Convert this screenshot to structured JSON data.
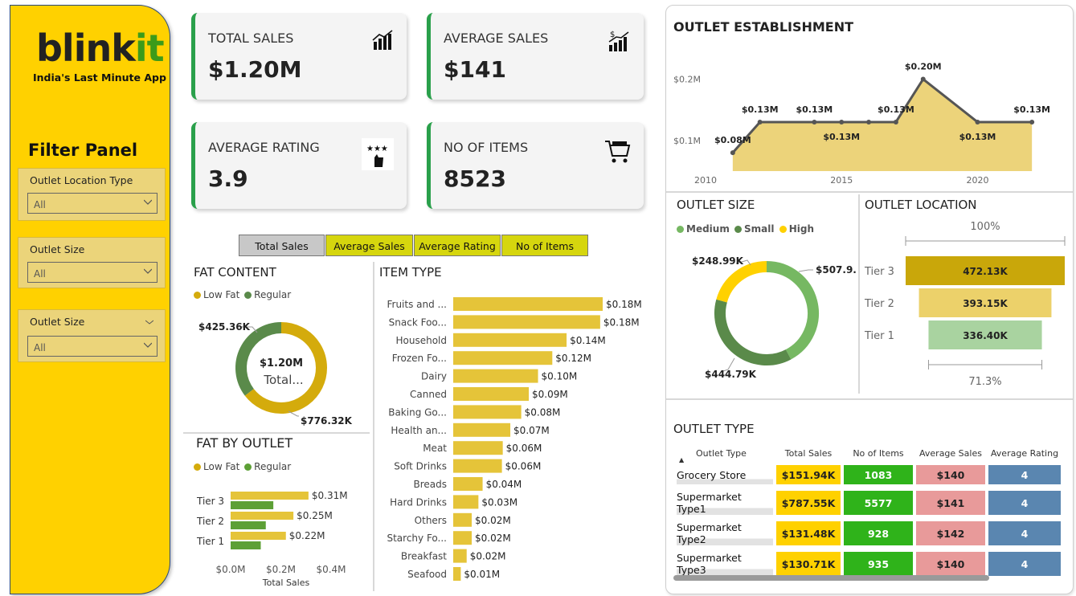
{
  "brand": {
    "logo_main": "blink",
    "logo_accent": "it",
    "tagline": "India's Last Minute App"
  },
  "filters": {
    "title": "Filter Panel",
    "items": [
      {
        "label": "Outlet Location Type",
        "value": "All"
      },
      {
        "label": "Outlet Size",
        "value": "All"
      },
      {
        "label": "Outlet Size",
        "value": "All"
      }
    ]
  },
  "kpis": [
    {
      "title": "TOTAL SALES",
      "value": "$1.20M",
      "icon": "bar-chart-up-icon"
    },
    {
      "title": "AVERAGE SALES",
      "value": "$141",
      "icon": "dollar-growth-icon"
    },
    {
      "title": "AVERAGE RATING",
      "value": "3.9",
      "icon": "star-rating-icon"
    },
    {
      "title": "NO OF ITEMS",
      "value": "8523",
      "icon": "shopping-cart-icon"
    }
  ],
  "tabs": [
    {
      "label": "Total Sales",
      "active": true
    },
    {
      "label": "Average Sales",
      "active": false
    },
    {
      "label": "Average Rating",
      "active": false
    },
    {
      "label": "No of Items",
      "active": false
    }
  ],
  "colors": {
    "accent_yellow": "#ffd100",
    "gold": "#d4ab0c",
    "bar_yellow": "#e5c439",
    "green_dark": "#5a8a4a",
    "green_bright": "#5da036",
    "green_kpi": "#2aa04b",
    "light_green": "#76b862"
  },
  "fat_content": {
    "title": "FAT CONTENT",
    "legend": [
      "Low Fat",
      "Regular"
    ],
    "center_value": "$1.20M",
    "center_label": "Total...",
    "chart_data": {
      "type": "pie",
      "labels": [
        "Low Fat",
        "Regular"
      ],
      "values": [
        776.32,
        425.36
      ],
      "value_labels": [
        "$776.32K",
        "$425.36K"
      ]
    }
  },
  "fat_by_outlet": {
    "title": "FAT BY OUTLET",
    "legend": [
      "Low Fat",
      "Regular"
    ],
    "xlabel": "Total Sales",
    "chart_data": {
      "type": "bar",
      "categories": [
        "Tier 3",
        "Tier 2",
        "Tier 1"
      ],
      "series": [
        {
          "name": "Low Fat",
          "values": [
            0.31,
            0.25,
            0.22
          ]
        },
        {
          "name": "Regular",
          "values": [
            0.17,
            0.14,
            0.12
          ]
        }
      ],
      "value_labels": [
        "$0.31M",
        "$0.25M",
        "$0.22M"
      ],
      "xticks": [
        "$0.0M",
        "$0.2M",
        "$0.4M"
      ],
      "xlim": [
        0,
        0.4
      ]
    }
  },
  "item_type": {
    "title": "ITEM TYPE",
    "chart_data": {
      "type": "bar",
      "categories": [
        "Fruits and ...",
        "Snack Foo...",
        "Household",
        "Frozen Fo...",
        "Dairy",
        "Canned",
        "Baking Go...",
        "Health an...",
        "Meat",
        "Soft Drinks",
        "Breads",
        "Hard Drinks",
        "Others",
        "Starchy Fo...",
        "Breakfast",
        "Seafood"
      ],
      "values": [
        0.178,
        0.175,
        0.135,
        0.118,
        0.101,
        0.09,
        0.081,
        0.068,
        0.059,
        0.058,
        0.035,
        0.03,
        0.022,
        0.022,
        0.016,
        0.009
      ],
      "value_labels": [
        "$0.18M",
        "$0.18M",
        "$0.14M",
        "$0.12M",
        "$0.10M",
        "$0.09M",
        "$0.08M",
        "$0.07M",
        "$0.06M",
        "$0.06M",
        "$0.04M",
        "$0.03M",
        "$0.02M",
        "$0.02M",
        "$0.02M",
        "$0.01M"
      ]
    }
  },
  "outlet_establishment": {
    "title": "OUTLET ESTABLISHMENT",
    "chart_data": {
      "type": "area",
      "x": [
        2011,
        2012,
        2014,
        2015,
        2016,
        2017,
        2018,
        2020,
        2022
      ],
      "values": [
        0.08,
        0.13,
        0.13,
        0.13,
        0.13,
        0.13,
        0.2,
        0.13,
        0.13
      ],
      "point_labels": [
        "$0.08M",
        "$0.13M",
        "$0.13M",
        "$0.13M",
        "",
        "$0.13M",
        "$0.20M",
        "$0.13M",
        "$0.13M"
      ],
      "yticks": [
        "$0.1M",
        "$0.2M"
      ],
      "xticks": [
        "2010",
        "2015",
        "2020"
      ],
      "xlim": [
        2010,
        2023
      ],
      "ylim": [
        0.05,
        0.24
      ]
    }
  },
  "outlet_size": {
    "title": "OUTLET SIZE",
    "legend": [
      "Medium",
      "Small",
      "High"
    ],
    "chart_data": {
      "type": "pie",
      "labels": [
        "Medium",
        "Small",
        "High"
      ],
      "values": [
        507.9,
        444.79,
        248.99
      ],
      "value_labels": [
        "$507.9...",
        "$444.79K",
        "$248.99K"
      ]
    }
  },
  "outlet_location": {
    "title": "OUTLET LOCATION",
    "top_label": "100%",
    "bottom_label": "71.3%",
    "chart_data": {
      "type": "bar",
      "categories": [
        "Tier 3",
        "Tier 2",
        "Tier 1"
      ],
      "values": [
        472.13,
        393.15,
        336.4
      ],
      "value_labels": [
        "472.13K",
        "393.15K",
        "336.40K"
      ]
    }
  },
  "outlet_type": {
    "title": "OUTLET TYPE",
    "headers": [
      "Outlet Type",
      "Total Sales",
      "No of Items",
      "Average Sales",
      "Average Rating"
    ],
    "rows": [
      [
        "Grocery Store",
        "$151.94K",
        "1083",
        "$140",
        "4"
      ],
      [
        "Supermarket Type1",
        "$787.55K",
        "5577",
        "$141",
        "4"
      ],
      [
        "Supermarket Type2",
        "$131.48K",
        "928",
        "$142",
        "4"
      ],
      [
        "Supermarket Type3",
        "$130.71K",
        "935",
        "$140",
        "4"
      ]
    ]
  }
}
